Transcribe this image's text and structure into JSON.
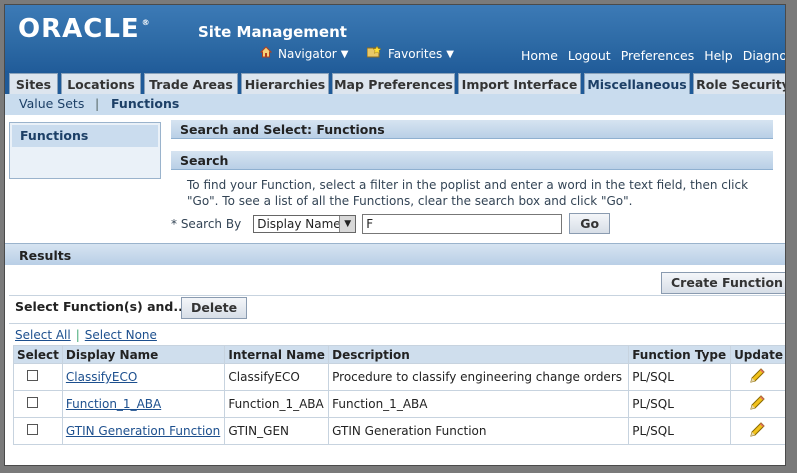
{
  "header": {
    "logo": "ORACLE",
    "app_title": "Site Management",
    "navigator": "Navigator",
    "favorites": "Favorites",
    "global_links": [
      "Home",
      "Logout",
      "Preferences",
      "Help",
      "Diagnosti"
    ]
  },
  "tabs": [
    {
      "label": "Sites"
    },
    {
      "label": "Locations"
    },
    {
      "label": "Trade Areas"
    },
    {
      "label": "Hierarchies"
    },
    {
      "label": "Map Preferences"
    },
    {
      "label": "Import Interface"
    },
    {
      "label": "Miscellaneous",
      "active": true
    },
    {
      "label": "Role Security"
    }
  ],
  "subtabs": {
    "value_sets": "Value Sets",
    "separator": "|",
    "functions": "Functions"
  },
  "sidenav": {
    "item": "Functions"
  },
  "search_panel": {
    "title": "Search and Select: Functions",
    "search_header": "Search",
    "instruction": "To find your Function, select a filter in the poplist and enter a word in the text field, then click \"Go\". To see a list of all the Functions, clear the search box and click \"Go\".",
    "search_by_label": "* Search By",
    "search_by_value": "Display Name",
    "search_text": "F",
    "go_label": "Go"
  },
  "results": {
    "header": "Results",
    "create_label": "Create Function",
    "select_label": "Select Function(s) and...",
    "delete_label": "Delete",
    "select_all": "Select All",
    "select_none": "Select None",
    "columns": [
      "Select",
      "Display Name",
      "Internal Name",
      "Description",
      "Function Type",
      "Update"
    ],
    "rows": [
      {
        "display_name": "ClassifyECO",
        "internal_name": "ClassifyECO",
        "description": "Procedure to classify engineering change orders",
        "function_type": "PL/SQL"
      },
      {
        "display_name": "Function_1_ABA",
        "internal_name": "Function_1_ABA",
        "description": "Function_1_ABA",
        "function_type": "PL/SQL"
      },
      {
        "display_name": "GTIN Generation Function",
        "internal_name": "GTIN_GEN",
        "description": "GTIN Generation Function",
        "function_type": "PL/SQL"
      }
    ]
  },
  "colors": {
    "header_blue": "#2d6aa5",
    "tab_active": "#c9dcee",
    "link": "#1c4f8e"
  }
}
